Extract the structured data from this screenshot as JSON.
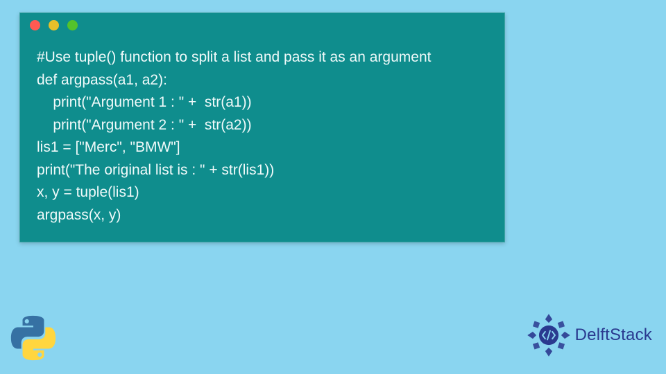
{
  "code": {
    "lines": [
      "#Use tuple() function to split a list and pass it as an argument",
      "def argpass(a1, a2):",
      "    print(\"Argument 1 : \" +  str(a1))",
      "    print(\"Argument 2 : \" +  str(a2))",
      "lis1 = [\"Merc\", \"BMW\"]",
      "print(\"The original list is : \" + str(lis1))",
      "x, y = tuple(lis1)",
      "argpass(x, y)"
    ]
  },
  "brand": {
    "name": "DelftStack"
  },
  "colors": {
    "page_bg": "#8ad5f0",
    "window_bg": "#0f8d8d",
    "code_fg": "#f0fafa",
    "dot_red": "#ff5a52",
    "dot_yellow": "#e6c029",
    "dot_green": "#54c22b",
    "delft_blue": "#2a3a8f"
  }
}
